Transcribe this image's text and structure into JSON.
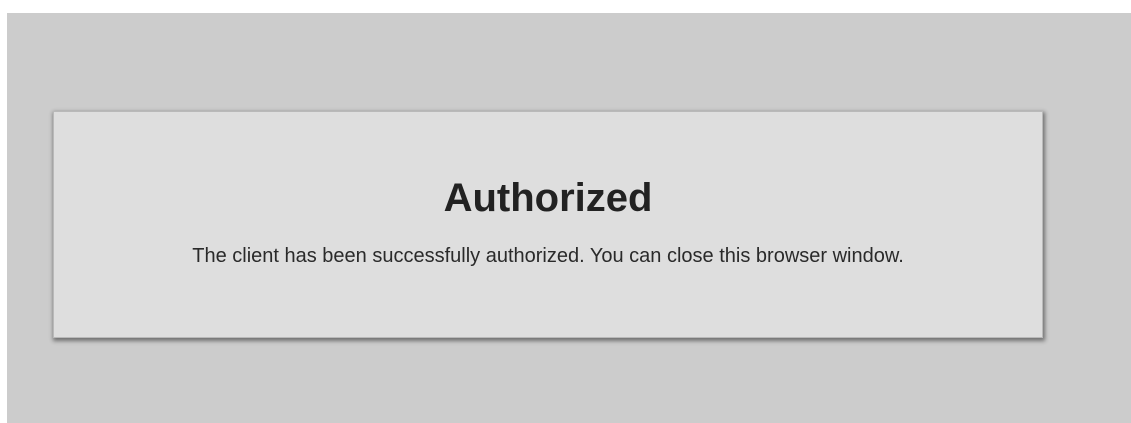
{
  "card": {
    "title": "Authorized",
    "message": "The client has been successfully authorized. You can close this browser window."
  },
  "colors": {
    "page_background": "#cccccc",
    "card_background": "#dedede",
    "text": "#222222"
  }
}
